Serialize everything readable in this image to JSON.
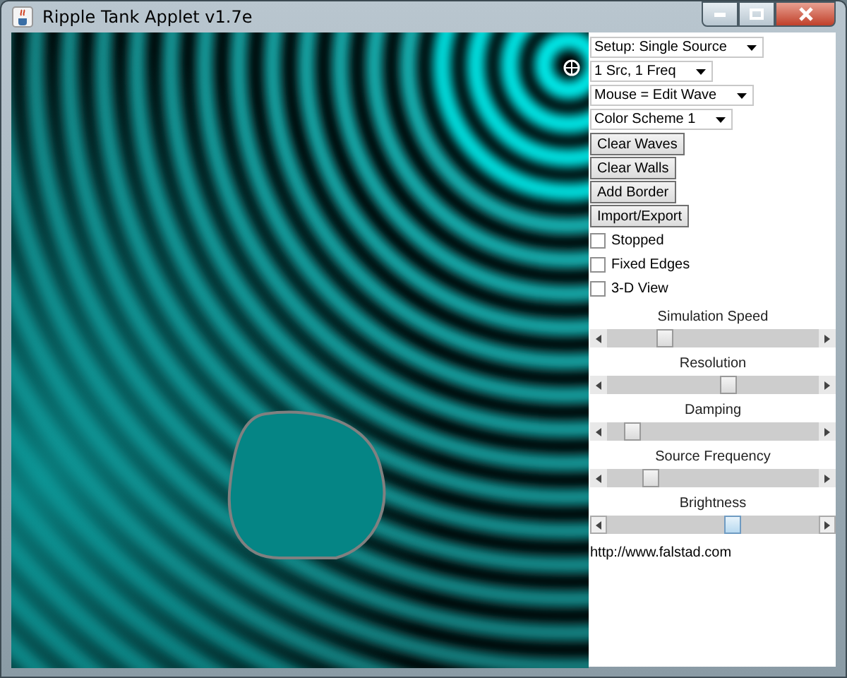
{
  "window": {
    "title": "Ripple Tank Applet v1.7e"
  },
  "dropdowns": [
    {
      "value": "Setup: Single Source"
    },
    {
      "value": "1 Src, 1 Freq"
    },
    {
      "value": "Mouse = Edit Wave"
    },
    {
      "value": "Color Scheme 1"
    }
  ],
  "buttons": [
    "Clear Waves",
    "Clear Walls",
    "Add Border",
    "Import/Export"
  ],
  "checkboxes": [
    {
      "label": "Stopped",
      "checked": false
    },
    {
      "label": "Fixed Edges",
      "checked": false
    },
    {
      "label": "3-D View",
      "checked": false
    }
  ],
  "sliders": [
    {
      "label": "Simulation Speed",
      "level": 0.25,
      "focused": false
    },
    {
      "label": "Resolution",
      "level": 0.58,
      "focused": false
    },
    {
      "label": "Damping",
      "level": 0.09,
      "focused": false
    },
    {
      "label": "Source Frequency",
      "level": 0.18,
      "focused": false
    },
    {
      "label": "Brightness",
      "level": 0.6,
      "focused": true
    }
  ],
  "link": "http://www.falstad.com"
}
